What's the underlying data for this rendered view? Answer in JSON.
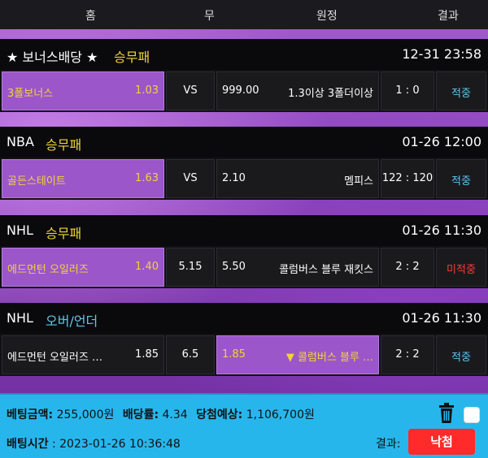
{
  "header": {
    "home": "홈",
    "draw": "무",
    "away": "원정",
    "result": "결과"
  },
  "sections": [
    {
      "league": "★ 보너스배당 ★",
      "market": "승무패",
      "market_color": "#f2d23c",
      "time": "12-31 23:58",
      "row": {
        "home": "3폴보너스",
        "home_odds": "1.03",
        "mid": "VS",
        "away_odds": "999.00",
        "away": "1.3이상 3폴더이상",
        "score": "1 : 0",
        "status": "적중"
      }
    },
    {
      "league": "NBA",
      "market": "승무패",
      "market_color": "#f2d23c",
      "time": "01-26 12:00",
      "row": {
        "home": "골든스테이트",
        "home_odds": "1.63",
        "mid": "VS",
        "away_odds": "2.10",
        "away": "멤피스",
        "score": "122 : 120",
        "status": "적중"
      }
    },
    {
      "league": "NHL",
      "market": "승무패",
      "market_color": "#f2d23c",
      "time": "01-26 11:30",
      "row": {
        "home": "에드먼턴 오일러즈",
        "home_odds": "1.40",
        "mid": "5.15",
        "away_odds": "5.50",
        "away": "콜럼버스 블루 재킷스",
        "score": "2 : 2",
        "status": "미적중"
      }
    },
    {
      "league": "NHL",
      "market": "오버/언더",
      "market_color": "#5fc7e8",
      "time": "01-26 11:30",
      "row": {
        "home": "에드먼턴 오일러즈 …",
        "home_odds": "1.85",
        "mid": "6.5",
        "away_odds": "1.85",
        "away": "▼ 콜럼버스 블루 …",
        "score": "2 : 2",
        "status": "적중"
      }
    }
  ],
  "summary": {
    "bet_amount_label": "베팅금액:",
    "bet_amount": "255,000원",
    "odds_label": "배당률:",
    "odds": "4.34",
    "expected_label": "당첨예상:",
    "expected": "1,106,700원",
    "time_label": "배팅시간",
    "time_value": ": 2023-01-26 10:36:48",
    "result_label": "결과:",
    "result": "낙첨"
  },
  "colors": {
    "gold": "#f2d23c",
    "cyan": "#5fc7e8",
    "loss_red": "#ff3a3a",
    "selected": "#9b57c9",
    "summary_bg": "#27b6ec",
    "result_btn": "#ff2a2a"
  }
}
